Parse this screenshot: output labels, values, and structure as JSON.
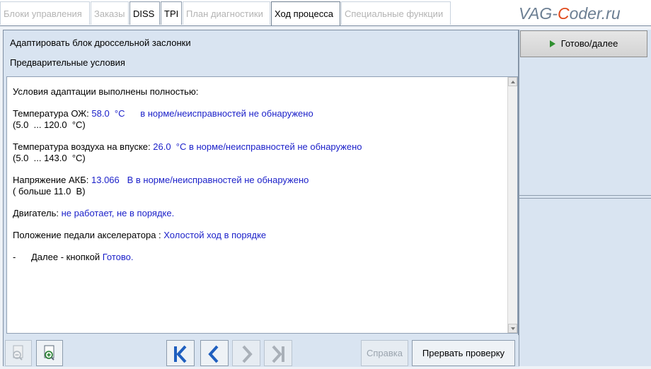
{
  "tabs": [
    {
      "label": "Блоки управления",
      "state": "disabled"
    },
    {
      "label": "Заказы",
      "state": "disabled"
    },
    {
      "label": "DISS",
      "state": "enabled"
    },
    {
      "label": "TPI",
      "state": "enabled"
    },
    {
      "label": "План диагностики",
      "state": "disabled"
    },
    {
      "label": "Ход процесса",
      "state": "active"
    },
    {
      "label": "Специальные функции",
      "state": "disabled"
    }
  ],
  "watermark": {
    "prefix": "VAG-",
    "c": "C",
    "suffix": "oder.ru"
  },
  "header": {
    "title": "Адаптировать блок дроссельной заслонки",
    "subtitle": "Предварительные условия"
  },
  "content": {
    "intro": "Условия адаптации выполнены полностью:",
    "coolant": {
      "label": "Температура ОЖ: ",
      "value": "58.0  °C      в норме/неисправностей не обнаружено",
      "range": "(5.0  ... 120.0  °C)"
    },
    "intake": {
      "label": "Температура воздуха на впуске: ",
      "value": "26.0  °C в норме/неисправностей не обнаружено",
      "range": "(5.0  ... 143.0  °C)"
    },
    "battery": {
      "label": "Напряжение АКБ: ",
      "value": "13.066   В в норме/неисправностей не обнаружено",
      "range": "( больше 11.0  В)"
    },
    "engine": {
      "label": "Двигатель: ",
      "value": "не работает, не в порядке."
    },
    "pedal": {
      "label": "Положение педали акселератора : ",
      "value": "Холостой ход в порядке"
    },
    "next": {
      "label": "-      Далее - кнопкой ",
      "value": "Готово."
    }
  },
  "toolbar": {
    "help_label": "Справка",
    "abort_label": "Прервать проверку"
  },
  "right_panel": {
    "ready_label": "Готово/далее"
  },
  "colors": {
    "value_blue": "#1a1fc9",
    "panel_bg": "#d9e4f1",
    "play_green": "#2f8f2f"
  }
}
